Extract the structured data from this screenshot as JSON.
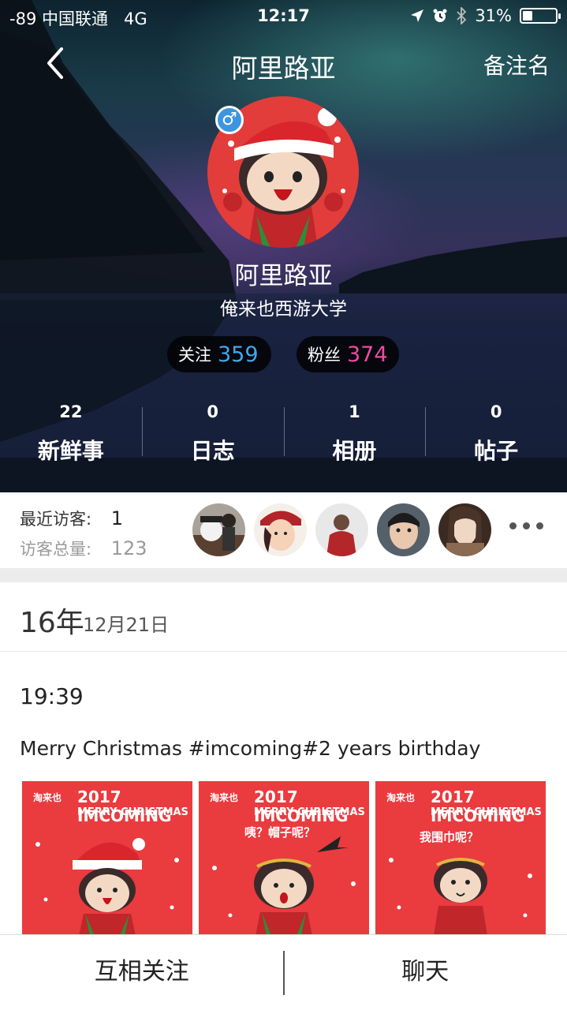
{
  "status_bar": {
    "signal": "-89",
    "carrier": "中国联通",
    "network": "4G",
    "time": "12:17",
    "battery": "31%",
    "battery_level": 0.31
  },
  "nav": {
    "title": "阿里路亚",
    "right_action": "备注名"
  },
  "profile": {
    "gender_symbol": "♂",
    "name": "阿里路亚",
    "school": "俺来也西游大学",
    "follow_label": "关注",
    "follow_count": "359",
    "fans_label": "粉丝",
    "fans_count": "374",
    "stats": [
      {
        "count": "22",
        "label": "新鲜事"
      },
      {
        "count": "0",
        "label": "日志"
      },
      {
        "count": "1",
        "label": "相册"
      },
      {
        "count": "0",
        "label": "帖子"
      }
    ]
  },
  "visitors": {
    "recent_label": "最近访客:",
    "recent_count": "1",
    "total_label": "访客总量:",
    "total_count": "123"
  },
  "feed": {
    "date_big": "16年",
    "date_small": "12月21日",
    "time": "19:39",
    "text": "Merry Christmas #imcoming#2 years birthday",
    "images": [
      {
        "brand": "淘来也",
        "title": "2017 IMCOMING",
        "subtitle": "MERRY CHRISTMAS",
        "caption": ""
      },
      {
        "brand": "淘来也",
        "title": "2017 IMCOMING",
        "subtitle": "MERRY CHRISTMAS",
        "caption": "咦？帽子呢？"
      },
      {
        "brand": "淘来也",
        "title": "2017 IMCOMING",
        "subtitle": "MERRY CHRISTMAS",
        "caption": "我围巾呢？"
      }
    ]
  },
  "bottom": {
    "mutual_follow": "互相关注",
    "chat": "聊天"
  },
  "colors": {
    "follow_count": "#3fa8ee",
    "fans_count": "#f04aa0",
    "avatar_bg": "#e23d3b",
    "post_image_bg": "#ea3b3f"
  }
}
